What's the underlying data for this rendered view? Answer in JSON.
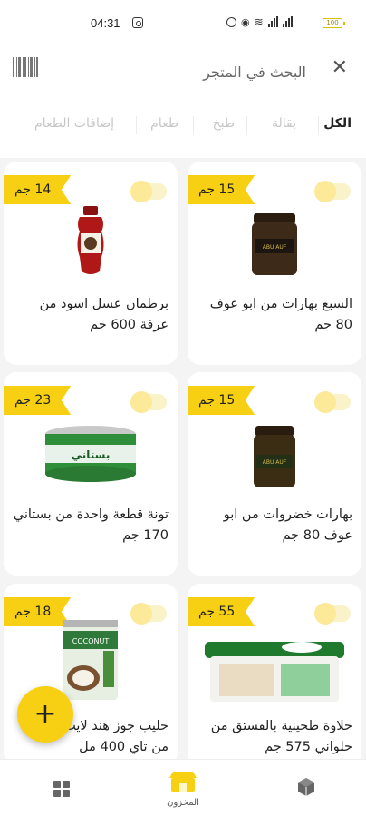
{
  "status_bar": {
    "time": "04:31",
    "battery": "100"
  },
  "search": {
    "placeholder_text": "البحث في المتجر",
    "close_icon": "close-icon",
    "barcode_icon": "barcode-icon"
  },
  "tabs": [
    {
      "label": "الكل",
      "active": true
    },
    {
      "label": "بقالة",
      "active": false
    },
    {
      "label": "طبخ",
      "active": false
    },
    {
      "label": "طعام",
      "active": false
    },
    {
      "label": "إضافات الطعام",
      "active": false
    }
  ],
  "products": [
    {
      "price": "14 جم",
      "name": "برطمان عسل اسود من عرفة 600 جم"
    },
    {
      "price": "15 جم",
      "name": "السبع بهارات من ابو عوف 80 جم"
    },
    {
      "price": "23 جم",
      "name": "تونة قطعة واحدة من بستاني 170 جم"
    },
    {
      "price": "15 جم",
      "name": "بهارات خضروات من ابو عوف 80 جم"
    },
    {
      "price": "18 جم",
      "name": "حليب جوز هند لايت من تاي 400 مل"
    },
    {
      "price": "55 جم",
      "name": "حلاوة طحينية بالفستق من حلواني 575 جم"
    }
  ],
  "fab": {
    "label": "+"
  },
  "bottom_nav": [
    {
      "icon": "grid-icon",
      "label": ""
    },
    {
      "icon": "store-icon",
      "label": "المخزون"
    },
    {
      "icon": "box-icon",
      "label": ""
    }
  ],
  "colors": {
    "accent": "#f8d013",
    "background": "#f4f4f4"
  }
}
